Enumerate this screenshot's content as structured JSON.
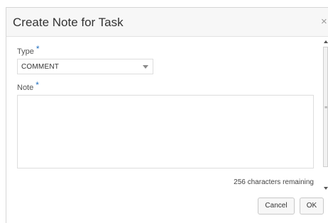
{
  "dialog": {
    "title": "Create Note for Task",
    "close_glyph": "×"
  },
  "form": {
    "type_label": "Type",
    "type_value": "COMMENT",
    "note_label": "Note",
    "required_marker": "*",
    "note_value": "",
    "chars_remaining": "256 characters remaining"
  },
  "buttons": {
    "cancel": "Cancel",
    "ok": "OK"
  },
  "icons": {
    "close": "close-icon",
    "dropdown": "chevron-down-icon",
    "scroll_up": "scroll-up-arrow-icon",
    "scroll_down": "scroll-down-arrow-icon",
    "grip": "scroll-grip-icon"
  },
  "colors": {
    "required": "#1f6ebf",
    "header_bg": "#f7f7f7"
  }
}
